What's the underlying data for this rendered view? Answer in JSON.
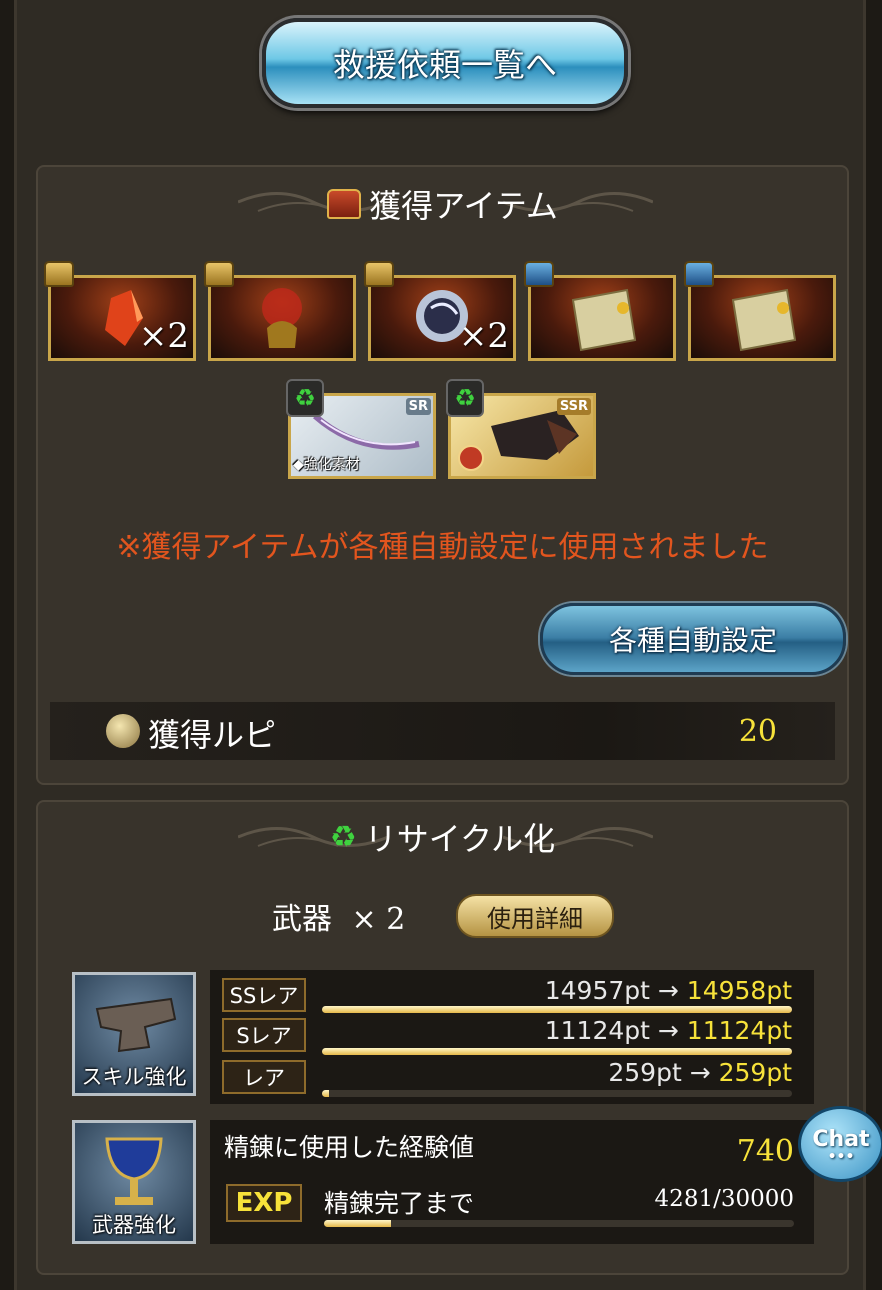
{
  "rescue_button_label": "救援依頼一覧へ",
  "acquired": {
    "title": "獲得アイテム",
    "items": [
      {
        "name": "red-crystal",
        "qty": "×2",
        "chest": "gold"
      },
      {
        "name": "red-helm",
        "qty": "",
        "chest": "gold"
      },
      {
        "name": "dark-orb",
        "qty": "×2",
        "chest": "gold"
      },
      {
        "name": "scroll",
        "qty": "",
        "chest": "blue"
      },
      {
        "name": "scroll",
        "qty": "",
        "chest": "blue"
      }
    ],
    "cards": [
      {
        "rarity": "SR",
        "label": "◆強化素材"
      },
      {
        "rarity": "SSR",
        "label": ""
      }
    ],
    "notice": "※獲得アイテムが各種自動設定に使用されました",
    "auto_button_label": "各種自動設定",
    "rupi_label": "獲得ルピ",
    "rupi_value": "20"
  },
  "recycle": {
    "title": "リサイクル化",
    "weapon_label": "武器",
    "weapon_count": "× 2",
    "detail_button_label": "使用詳細",
    "skill_icon_label": "スキル強化",
    "rarities": [
      {
        "tag": "SSレア",
        "before": "14957pt",
        "arrow": "→",
        "after": "14958pt",
        "fill": 1.0
      },
      {
        "tag": "Sレア",
        "before": "11124pt",
        "arrow": "→",
        "after": "11124pt",
        "fill": 1.0
      },
      {
        "tag": "レア",
        "before": "259pt",
        "arrow": "→",
        "after": "259pt",
        "fill": 0.015
      }
    ],
    "weapon_icon_label": "武器強化",
    "refine_label": "精錬に使用した経験値",
    "refine_value": "740",
    "exp_tag": "EXP",
    "until_label": "精錬完了まで",
    "exp_progress": "4281/30000",
    "exp_fill": 0.1427
  },
  "chat_label": "Chat",
  "chat_dots": "•••",
  "colors": {
    "notice": "#e2551e",
    "value_yellow": "#f7e23a",
    "gold_border": "#c9a64a"
  }
}
